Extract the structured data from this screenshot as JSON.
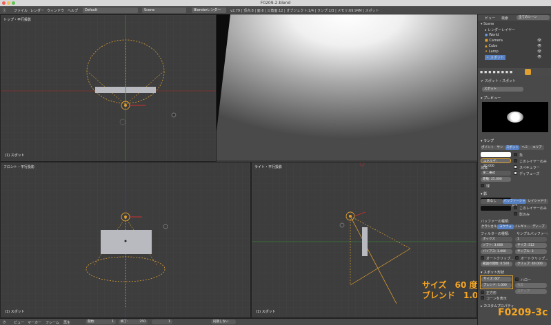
{
  "window_title": "F0209-2.blend",
  "top_menu": [
    "ファイル",
    "レンダー",
    "ウィンドウ",
    "ヘルプ"
  ],
  "layout_select": "Default",
  "scene_select": "Scene",
  "engine_select": "Blenderレンダー",
  "status_info": "v2.79 | 頂点:8 | 面:6 | 三角面:12 | オブジェクト:1/4 | ランプ:1/3 | メモリ:69.94M | スポット",
  "viewports": {
    "top_label": "トップ・平行投影",
    "top_bottom": "(1) スポット",
    "front_label": "フロント・平行投影",
    "front_bottom": "(1) スポット",
    "right_label": "ライト・平行投影",
    "right_bottom": "(1) スポット"
  },
  "outliner": {
    "header_view": "ビュー",
    "header_search": "検索",
    "header_scenes": "全てのシーン",
    "items": [
      "Scene",
      "レンダーレイヤー",
      "World",
      "Camera",
      "Cube",
      "Lamp",
      "スポット"
    ]
  },
  "props": {
    "breadcrumb_1": "スポット",
    "breadcrumb_2": "スポット",
    "datablock": "スポット",
    "preview_label": "プレビュー",
    "lamp_label": "ランプ",
    "lamp_types": [
      "ポイント",
      "サン",
      "スポット",
      "ヘミ",
      "エリア"
    ],
    "lamp_type_selected": 2,
    "energy": "エネルギ: 20.000",
    "negative": "負",
    "this_layer": "このレイヤーのみ",
    "specular": "スペキュラー",
    "diffuse": "ディフューズ",
    "falloff_label": "減衰:",
    "falloff_value": "逆二乗式",
    "distance": "距離:    25.000",
    "sphere": "球",
    "shadow_label": "影",
    "shadow_types": [
      "影なし",
      "バッファーシャドウ",
      "レイシャドウ"
    ],
    "this_layer2": "このレイヤーのみ",
    "shadow_only": "影のみ",
    "buffer_type_label": "バッファーの種類:",
    "buffer_types": [
      "クラシカル",
      "ヨウウォ",
      "イレギュ...",
      "ディープ"
    ],
    "filter_label": "フィルターの種類:",
    "sample_buffer_label": "サンプルバッファー:",
    "filter_value": "ボックス",
    "sample_value": "1",
    "soft": "ソフト:   3.000",
    "size": "サイズ:   512",
    "bias": "バイアス:  1.000",
    "samples": "サンプル:   3",
    "auto_clip_start": "オートクリップ...",
    "auto_clip_end": "オートクリップ...",
    "clip_start": "範囲の開始: 0.500",
    "clip_end": "クリップ: 40.000",
    "spot_shape_label": "スポット形状",
    "spot_size": "サイズ:    60°",
    "spot_blend": "ブレンド:  1.000",
    "halo": "ハロー",
    "square": "正方形",
    "show_cone": "コーンを表示",
    "intensity": "強度",
    "step": "ステップ",
    "custom_props": "カスタムプロパティ"
  },
  "timeline": {
    "menus": [
      "ビュー",
      "マーカー",
      "フレーム",
      "再生"
    ],
    "start": "開始:",
    "start_val": "1",
    "end": "終了:",
    "end_val": "250",
    "current": "1",
    "sync": "同期しない"
  },
  "overlay": {
    "line1": "サイズ　60 度",
    "line2": "ブレンド　1.0",
    "figure_id": "F0209-3c"
  },
  "colors": {
    "accent": "#f5a623",
    "selected": "#5680c2"
  }
}
